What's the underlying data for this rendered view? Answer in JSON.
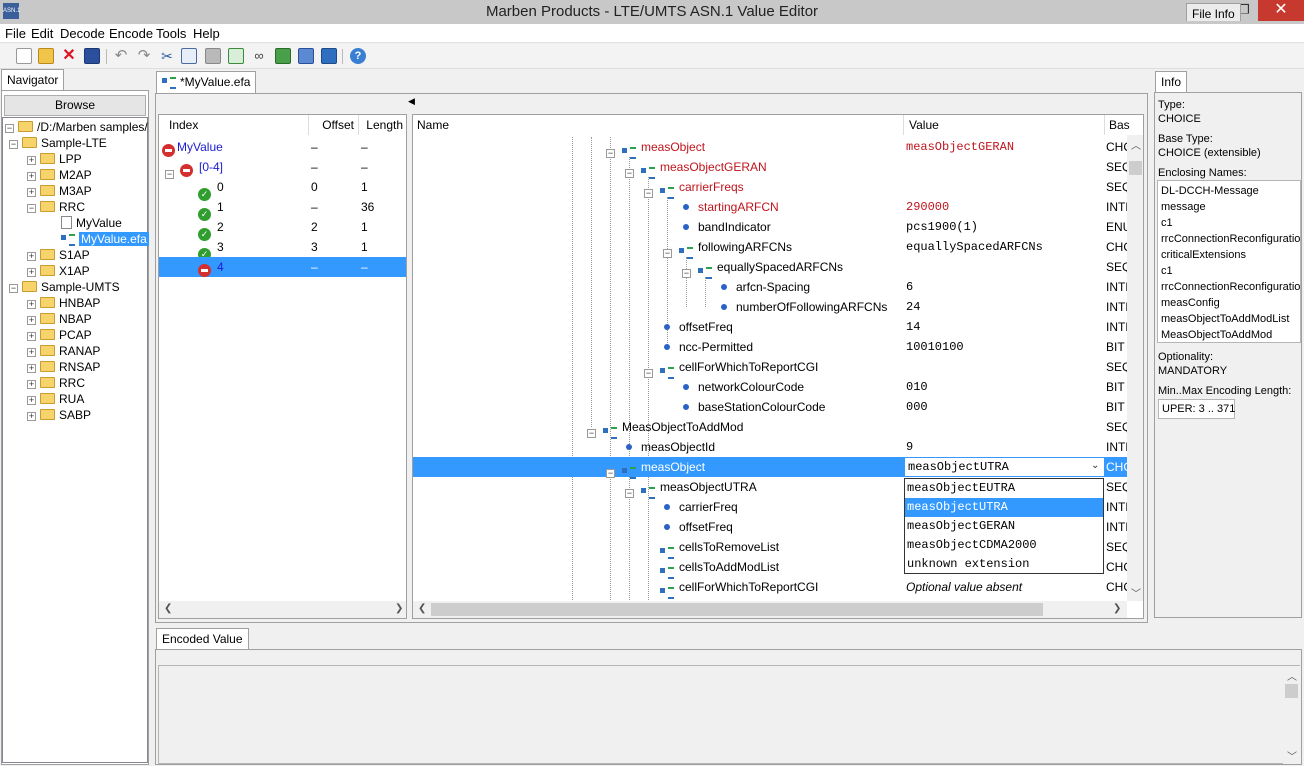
{
  "window": {
    "title": "Marben Products - LTE/UMTS ASN.1 Value Editor",
    "icon": "ASN.1",
    "minimize": "—",
    "maximize": "❐",
    "close": "✕"
  },
  "menu": [
    "File",
    "Edit",
    "Decode",
    "Encode",
    "Tools",
    "Help"
  ],
  "toolbar_icons": [
    "new-icon",
    "open-icon",
    "delete-icon",
    "save-icon",
    "undo-icon",
    "redo-icon",
    "cut-icon",
    "copy-icon",
    "paste-icon",
    "export-icon",
    "link-icon",
    "encode-icon",
    "decode-icon",
    "compare-icon",
    "help-icon"
  ],
  "navigator": {
    "tab": "Navigator",
    "browse": "Browse",
    "root": "/D:/Marben samples/",
    "lte": {
      "label": "Sample-LTE",
      "items": [
        "LPP",
        "M2AP",
        "M3AP",
        "RRC",
        "S1AP",
        "X1AP"
      ],
      "rrc_children": [
        "MyValue",
        "MyValue.efa"
      ]
    },
    "umts": {
      "label": "Sample-UMTS",
      "items": [
        "HNBAP",
        "NBAP",
        "PCAP",
        "RANAP",
        "RNSAP",
        "RRC",
        "RUA",
        "SABP"
      ]
    }
  },
  "editor_tab": "*MyValue.efa",
  "index_table": {
    "headers": [
      "Index",
      "Offset",
      "Length"
    ],
    "rows": [
      {
        "index": "MyValue",
        "offset": "–",
        "length": "–"
      },
      {
        "index": "[0-4]",
        "offset": "–",
        "length": "–"
      },
      {
        "index": "0",
        "offset": "0",
        "length": "1"
      },
      {
        "index": "1",
        "offset": "–",
        "length": "36"
      },
      {
        "index": "2",
        "offset": "2",
        "length": "1"
      },
      {
        "index": "3",
        "offset": "3",
        "length": "1"
      },
      {
        "index": "4",
        "offset": "–",
        "length": "–"
      }
    ]
  },
  "tree_table": {
    "headers": [
      "Name",
      "Value",
      "Bas"
    ],
    "rows": [
      {
        "name": "measObject",
        "value": "measObjectGERAN",
        "base": "CHC"
      },
      {
        "name": "measObjectGERAN",
        "value": "",
        "base": "SEQ"
      },
      {
        "name": "carrierFreqs",
        "value": "",
        "base": "SEQ"
      },
      {
        "name": "startingARFCN",
        "value": "290000",
        "base": "INTE"
      },
      {
        "name": "bandIndicator",
        "value": "pcs1900(1)",
        "base": "ENU"
      },
      {
        "name": "followingARFCNs",
        "value": "equallySpacedARFCNs",
        "base": "CHC"
      },
      {
        "name": "equallySpacedARFCNs",
        "value": "",
        "base": "SEQ"
      },
      {
        "name": "arfcn-Spacing",
        "value": "6",
        "base": "INTE"
      },
      {
        "name": "numberOfFollowingARFCNs",
        "value": "24",
        "base": "INTE"
      },
      {
        "name": "offsetFreq",
        "value": "14",
        "base": "INTE"
      },
      {
        "name": "ncc-Permitted",
        "value": "10010100",
        "base": "BIT S"
      },
      {
        "name": "cellForWhichToReportCGI",
        "value": "",
        "base": "SEQ"
      },
      {
        "name": "networkColourCode",
        "value": "010",
        "base": "BIT S"
      },
      {
        "name": "baseStationColourCode",
        "value": "000",
        "base": "BIT S"
      },
      {
        "name": "MeasObjectToAddMod",
        "value": "",
        "base": "SEQ"
      },
      {
        "name": "measObjectId",
        "value": "9",
        "base": "INTE"
      },
      {
        "name": "measObject",
        "value": "measObjectUTRA",
        "base": "CHC"
      },
      {
        "name": "measObjectUTRA",
        "value": "",
        "base": "SEQ"
      },
      {
        "name": "carrierFreq",
        "value": "",
        "base": "INTE"
      },
      {
        "name": "offsetFreq",
        "value": "",
        "base": "INTE"
      },
      {
        "name": "cellsToRemoveList",
        "value": "",
        "base": "SEQ"
      },
      {
        "name": "cellsToAddModList",
        "value": "",
        "base": "CHC"
      },
      {
        "name": "cellForWhichToReportCGI",
        "value": "Optional value absent",
        "base": "CHC"
      }
    ]
  },
  "dropdown": {
    "options": [
      "measObjectEUTRA",
      "measObjectUTRA",
      "measObjectGERAN",
      "measObjectCDMA2000",
      "unknown extension"
    ],
    "selected": "measObjectUTRA"
  },
  "info": {
    "tabs": [
      "Info",
      "File Info"
    ],
    "type_label": "Type:",
    "type": "CHOICE",
    "base_type_label": "Base Type:",
    "base_type": "CHOICE (extensible)",
    "enclosing_label": "Enclosing Names:",
    "enclosing": [
      "DL-DCCH-Message",
      "message",
      "c1",
      "rrcConnectionReconfiguration",
      "criticalExtensions",
      "c1",
      "rrcConnectionReconfiguration",
      "measConfig",
      "measObjectToAddModList",
      "MeasObjectToAddMod"
    ],
    "optionality_label": "Optionality:",
    "optionality": "MANDATORY",
    "minmax_label": "Min..Max Encoding Length:",
    "minmax": "UPER: 3 .. 371"
  },
  "encoded_tab": "Encoded Value"
}
